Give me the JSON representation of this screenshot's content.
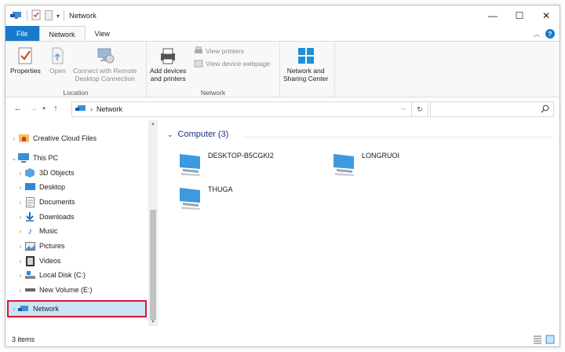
{
  "window": {
    "title": "Network"
  },
  "ribbon_tabs": [
    "File",
    "Network",
    "View"
  ],
  "ribbon": {
    "properties": "Properties",
    "open": "Open",
    "remote_desktop": [
      "Connect with Remote",
      "Desktop Connection"
    ],
    "location_label": "Location",
    "add_devices": [
      "Add devices",
      "and printers"
    ],
    "view_printers": "View printers",
    "view_device_webpage": "View device webpage",
    "network_label": "Network",
    "network_sharing": [
      "Network and",
      "Sharing Center"
    ]
  },
  "address": {
    "path": "Network"
  },
  "nav_tree": [
    {
      "label": "Creative Cloud Files",
      "icon": "creative-cloud-icon"
    },
    {
      "label": "This PC",
      "icon": "pc-icon"
    },
    {
      "label": "3D Objects",
      "icon": "3d-objects-icon"
    },
    {
      "label": "Desktop",
      "icon": "desktop-icon"
    },
    {
      "label": "Documents",
      "icon": "documents-icon"
    },
    {
      "label": "Downloads",
      "icon": "downloads-icon"
    },
    {
      "label": "Music",
      "icon": "music-icon"
    },
    {
      "label": "Pictures",
      "icon": "pictures-icon"
    },
    {
      "label": "Videos",
      "icon": "videos-icon"
    },
    {
      "label": "Local Disk (C:)",
      "icon": "local-disk-icon"
    },
    {
      "label": "New Volume (E:)",
      "icon": "drive-icon"
    },
    {
      "label": "Network",
      "icon": "network-icon"
    }
  ],
  "content": {
    "group_header": "Computer (3)",
    "computers": [
      "DESKTOP-B5CGKI2",
      "LONGRUOI",
      "THUGA"
    ]
  },
  "status": {
    "items": "3 items"
  },
  "colors": {
    "accent": "#1979ca",
    "selection": "#cce4f7",
    "highlight_border": "#d8182f",
    "group_header": "#1e3287"
  }
}
